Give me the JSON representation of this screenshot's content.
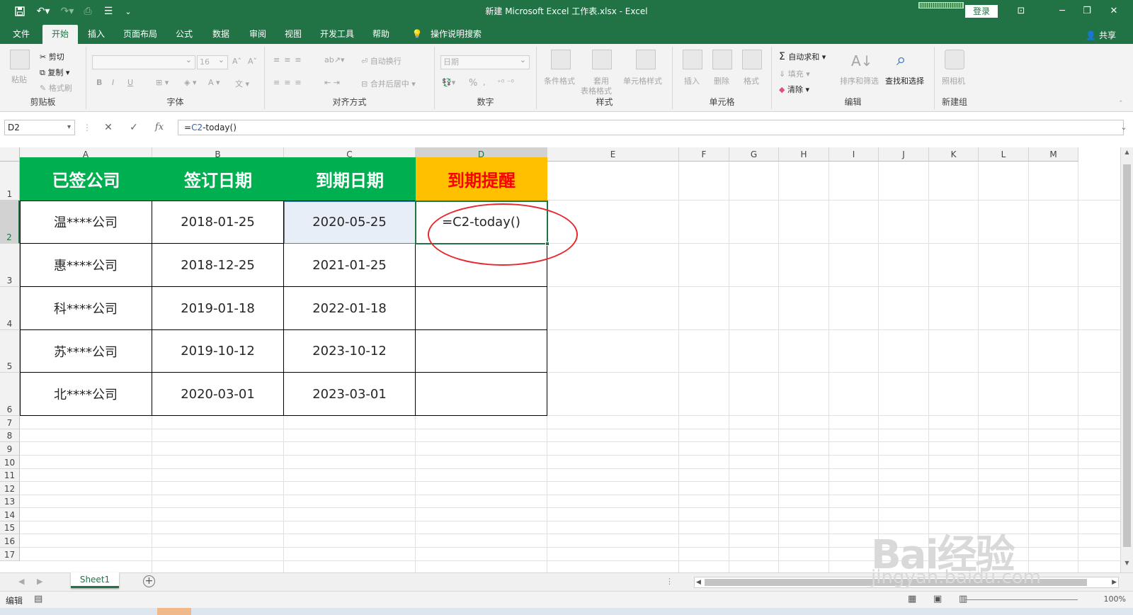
{
  "app": {
    "title": "新建 Microsoft Excel 工作表.xlsx  -  Excel",
    "login_label": "登录",
    "share_label": "共享"
  },
  "tabs": [
    "文件",
    "开始",
    "插入",
    "页面布局",
    "公式",
    "数据",
    "审阅",
    "视图",
    "开发工具",
    "帮助",
    "操作说明搜索"
  ],
  "active_tab": "开始",
  "ribbon": {
    "clipboard": {
      "label": "剪贴板",
      "paste": "粘贴",
      "cut": "剪切",
      "copy": "复制",
      "format_painter": "格式刷"
    },
    "font": {
      "label": "字体",
      "font_size": "16",
      "bold": "B",
      "italic": "I",
      "underline": "U"
    },
    "alignment": {
      "label": "对齐方式",
      "wrap": "自动换行",
      "merge": "合并后居中"
    },
    "number": {
      "label": "数字",
      "format": "日期",
      "percent": "%"
    },
    "styles": {
      "label": "样式",
      "cond_format": "条件格式",
      "table_format_1": "套用",
      "table_format_2": "表格格式",
      "cell_styles": "单元格样式"
    },
    "cells": {
      "label": "单元格",
      "insert": "插入",
      "delete": "删除",
      "format": "格式"
    },
    "editing": {
      "label": "编辑",
      "autosum": "自动求和",
      "fill": "填充",
      "clear": "清除",
      "sort": "排序和筛选",
      "find": "查找和选择"
    },
    "newgroup": {
      "label": "新建组",
      "camera": "照相机"
    }
  },
  "formula_bar": {
    "name_box": "D2",
    "formula": "=C2-today()",
    "formula_prefix": "=",
    "formula_ref": "C2",
    "formula_rest": "-today()"
  },
  "columns": [
    "A",
    "B",
    "C",
    "D",
    "E",
    "F",
    "G",
    "H",
    "I",
    "J",
    "K",
    "L",
    "M"
  ],
  "rows": [
    "1",
    "2",
    "3",
    "4",
    "5",
    "6",
    "7",
    "8",
    "9",
    "10",
    "11",
    "12",
    "13",
    "14",
    "15",
    "16",
    "17"
  ],
  "table": {
    "headers": [
      "已签公司",
      "签订日期",
      "到期日期",
      "到期提醒"
    ],
    "rows": [
      [
        "温****公司",
        "2018-01-25",
        "2020-05-25",
        "=C2-today()"
      ],
      [
        "惠****公司",
        "2018-12-25",
        "2021-01-25",
        ""
      ],
      [
        "科****公司",
        "2019-01-18",
        "2022-01-18",
        ""
      ],
      [
        "苏****公司",
        "2019-10-12",
        "2023-10-12",
        ""
      ],
      [
        "北****公司",
        "2020-03-01",
        "2023-03-01",
        ""
      ]
    ]
  },
  "colors": {
    "excel_green": "#217346",
    "header_fill": "#00b050",
    "reminder_fill": "#ffc000",
    "reminder_text": "#ff0000",
    "annotation_circle": "#e8282d",
    "selected_cell_fill": "#e8eef8"
  },
  "sheets": [
    "Sheet1"
  ],
  "status": {
    "mode": "编辑",
    "zoom": "100%"
  },
  "watermark": {
    "big": "Bai经验",
    "small": "jingyan.baidu.com"
  }
}
